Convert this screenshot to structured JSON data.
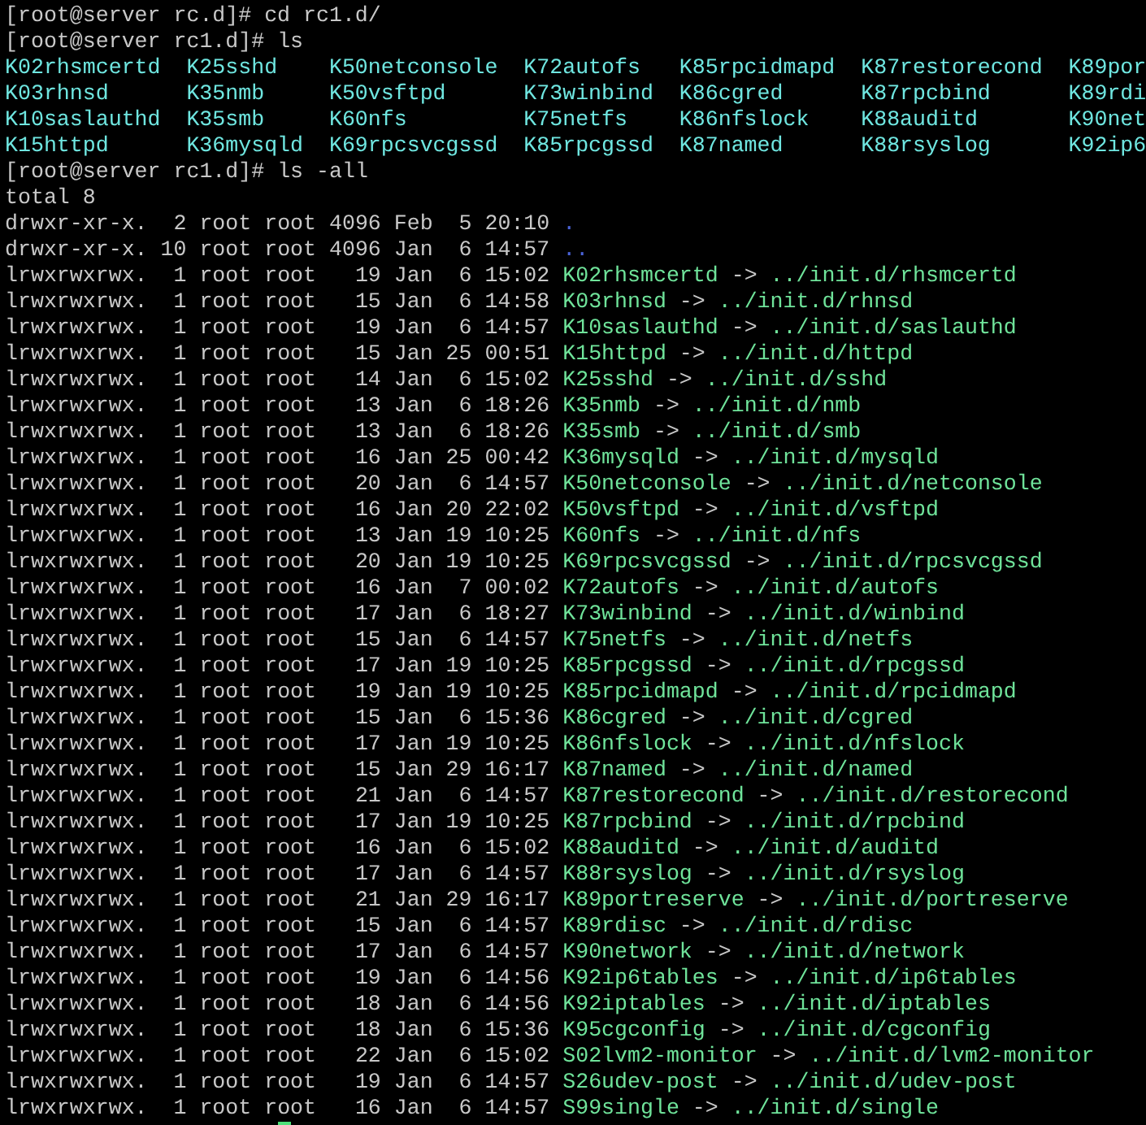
{
  "lines": [
    {
      "kind": "prompt",
      "prompt": "[root@server rc.d]#",
      "command": "cd rc1.d/"
    },
    {
      "kind": "prompt",
      "prompt": "[root@server rc1.d]#",
      "command": "ls"
    },
    {
      "kind": "grid",
      "cells": [
        "K02rhsmcertd",
        "K25sshd",
        "K50netconsole",
        "K72autofs",
        "K85rpcidmapd",
        "K87restorecond",
        "K89por"
      ]
    },
    {
      "kind": "grid",
      "cells": [
        "K03rhnsd",
        "K35nmb",
        "K50vsftpd",
        "K73winbind",
        "K86cgred",
        "K87rpcbind",
        "K89rdi"
      ]
    },
    {
      "kind": "grid",
      "cells": [
        "K10saslauthd",
        "K35smb",
        "K60nfs",
        "K75netfs",
        "K86nfslock",
        "K88auditd",
        "K90net"
      ]
    },
    {
      "kind": "grid",
      "cells": [
        "K15httpd",
        "K36mysqld",
        "K69rpcsvcgssd",
        "K85rpcgssd",
        "K87named",
        "K88rsyslog",
        "K92ip6"
      ]
    },
    {
      "kind": "prompt",
      "prompt": "[root@server rc1.d]#",
      "command": "ls -all"
    },
    {
      "kind": "text",
      "text": "total 8"
    },
    {
      "kind": "dir",
      "meta": "drwxr-xr-x.  2 root root 4096 Feb  5 20:10",
      "name": "."
    },
    {
      "kind": "dir",
      "meta": "drwxr-xr-x. 10 root root 4096 Jan  6 14:57",
      "name": ".."
    },
    {
      "kind": "link",
      "meta": "lrwxrwxrwx.  1 root root   19 Jan  6 15:02",
      "name": "K02rhsmcertd",
      "arrow": "->",
      "target": "../init.d/rhsmcertd"
    },
    {
      "kind": "link",
      "meta": "lrwxrwxrwx.  1 root root   15 Jan  6 14:58",
      "name": "K03rhnsd",
      "arrow": "->",
      "target": "../init.d/rhnsd"
    },
    {
      "kind": "link",
      "meta": "lrwxrwxrwx.  1 root root   19 Jan  6 14:57",
      "name": "K10saslauthd",
      "arrow": "->",
      "target": "../init.d/saslauthd"
    },
    {
      "kind": "link",
      "meta": "lrwxrwxrwx.  1 root root   15 Jan 25 00:51",
      "name": "K15httpd",
      "arrow": "->",
      "target": "../init.d/httpd"
    },
    {
      "kind": "link",
      "meta": "lrwxrwxrwx.  1 root root   14 Jan  6 15:02",
      "name": "K25sshd",
      "arrow": "->",
      "target": "../init.d/sshd"
    },
    {
      "kind": "link",
      "meta": "lrwxrwxrwx.  1 root root   13 Jan  6 18:26",
      "name": "K35nmb",
      "arrow": "->",
      "target": "../init.d/nmb"
    },
    {
      "kind": "link",
      "meta": "lrwxrwxrwx.  1 root root   13 Jan  6 18:26",
      "name": "K35smb",
      "arrow": "->",
      "target": "../init.d/smb"
    },
    {
      "kind": "link",
      "meta": "lrwxrwxrwx.  1 root root   16 Jan 25 00:42",
      "name": "K36mysqld",
      "arrow": "->",
      "target": "../init.d/mysqld"
    },
    {
      "kind": "link",
      "meta": "lrwxrwxrwx.  1 root root   20 Jan  6 14:57",
      "name": "K50netconsole",
      "arrow": "->",
      "target": "../init.d/netconsole"
    },
    {
      "kind": "link",
      "meta": "lrwxrwxrwx.  1 root root   16 Jan 20 22:02",
      "name": "K50vsftpd",
      "arrow": "->",
      "target": "../init.d/vsftpd"
    },
    {
      "kind": "link",
      "meta": "lrwxrwxrwx.  1 root root   13 Jan 19 10:25",
      "name": "K60nfs",
      "arrow": "->",
      "target": "../init.d/nfs"
    },
    {
      "kind": "link",
      "meta": "lrwxrwxrwx.  1 root root   20 Jan 19 10:25",
      "name": "K69rpcsvcgssd",
      "arrow": "->",
      "target": "../init.d/rpcsvcgssd"
    },
    {
      "kind": "link",
      "meta": "lrwxrwxrwx.  1 root root   16 Jan  7 00:02",
      "name": "K72autofs",
      "arrow": "->",
      "target": "../init.d/autofs"
    },
    {
      "kind": "link",
      "meta": "lrwxrwxrwx.  1 root root   17 Jan  6 18:27",
      "name": "K73winbind",
      "arrow": "->",
      "target": "../init.d/winbind"
    },
    {
      "kind": "link",
      "meta": "lrwxrwxrwx.  1 root root   15 Jan  6 14:57",
      "name": "K75netfs",
      "arrow": "->",
      "target": "../init.d/netfs"
    },
    {
      "kind": "link",
      "meta": "lrwxrwxrwx.  1 root root   17 Jan 19 10:25",
      "name": "K85rpcgssd",
      "arrow": "->",
      "target": "../init.d/rpcgssd"
    },
    {
      "kind": "link",
      "meta": "lrwxrwxrwx.  1 root root   19 Jan 19 10:25",
      "name": "K85rpcidmapd",
      "arrow": "->",
      "target": "../init.d/rpcidmapd"
    },
    {
      "kind": "link",
      "meta": "lrwxrwxrwx.  1 root root   15 Jan  6 15:36",
      "name": "K86cgred",
      "arrow": "->",
      "target": "../init.d/cgred"
    },
    {
      "kind": "link",
      "meta": "lrwxrwxrwx.  1 root root   17 Jan 19 10:25",
      "name": "K86nfslock",
      "arrow": "->",
      "target": "../init.d/nfslock"
    },
    {
      "kind": "link",
      "meta": "lrwxrwxrwx.  1 root root   15 Jan 29 16:17",
      "name": "K87named",
      "arrow": "->",
      "target": "../init.d/named"
    },
    {
      "kind": "link",
      "meta": "lrwxrwxrwx.  1 root root   21 Jan  6 14:57",
      "name": "K87restorecond",
      "arrow": "->",
      "target": "../init.d/restorecond"
    },
    {
      "kind": "link",
      "meta": "lrwxrwxrwx.  1 root root   17 Jan 19 10:25",
      "name": "K87rpcbind",
      "arrow": "->",
      "target": "../init.d/rpcbind"
    },
    {
      "kind": "link",
      "meta": "lrwxrwxrwx.  1 root root   16 Jan  6 15:02",
      "name": "K88auditd",
      "arrow": "->",
      "target": "../init.d/auditd"
    },
    {
      "kind": "link",
      "meta": "lrwxrwxrwx.  1 root root   17 Jan  6 14:57",
      "name": "K88rsyslog",
      "arrow": "->",
      "target": "../init.d/rsyslog"
    },
    {
      "kind": "link",
      "meta": "lrwxrwxrwx.  1 root root   21 Jan 29 16:17",
      "name": "K89portreserve",
      "arrow": "->",
      "target": "../init.d/portreserve"
    },
    {
      "kind": "link",
      "meta": "lrwxrwxrwx.  1 root root   15 Jan  6 14:57",
      "name": "K89rdisc",
      "arrow": "->",
      "target": "../init.d/rdisc"
    },
    {
      "kind": "link",
      "meta": "lrwxrwxrwx.  1 root root   17 Jan  6 14:57",
      "name": "K90network",
      "arrow": "->",
      "target": "../init.d/network"
    },
    {
      "kind": "link",
      "meta": "lrwxrwxrwx.  1 root root   19 Jan  6 14:56",
      "name": "K92ip6tables",
      "arrow": "->",
      "target": "../init.d/ip6tables"
    },
    {
      "kind": "link",
      "meta": "lrwxrwxrwx.  1 root root   18 Jan  6 14:56",
      "name": "K92iptables",
      "arrow": "->",
      "target": "../init.d/iptables"
    },
    {
      "kind": "link",
      "meta": "lrwxrwxrwx.  1 root root   18 Jan  6 15:36",
      "name": "K95cgconfig",
      "arrow": "->",
      "target": "../init.d/cgconfig"
    },
    {
      "kind": "link",
      "meta": "lrwxrwxrwx.  1 root root   22 Jan  6 15:02",
      "name": "S02lvm2-monitor",
      "arrow": "->",
      "target": "../init.d/lvm2-monitor"
    },
    {
      "kind": "link",
      "meta": "lrwxrwxrwx.  1 root root   19 Jan  6 14:57",
      "name": "S26udev-post",
      "arrow": "->",
      "target": "../init.d/udev-post"
    },
    {
      "kind": "link",
      "meta": "lrwxrwxrwx.  1 root root   16 Jan  6 14:57",
      "name": "S99single",
      "arrow": "->",
      "target": "../init.d/single"
    },
    {
      "kind": "cursor"
    }
  ]
}
